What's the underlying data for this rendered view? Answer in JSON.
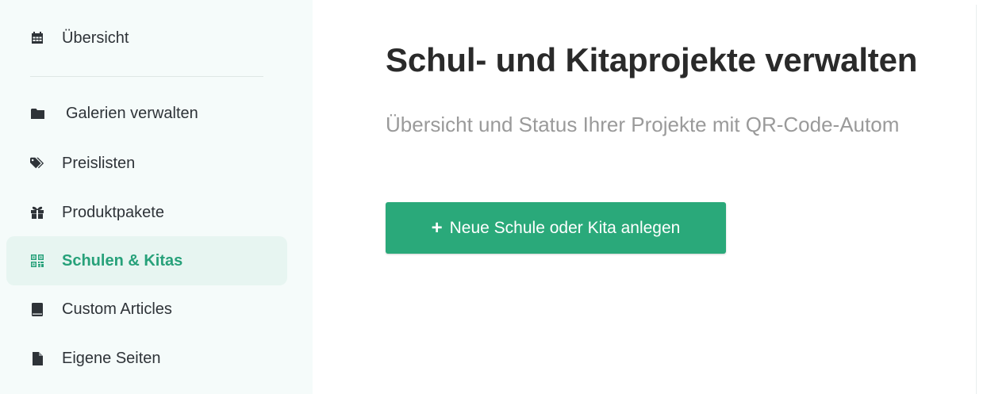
{
  "sidebar": {
    "items": [
      {
        "label": "Übersicht",
        "icon": "calendar-icon",
        "active": false
      },
      {
        "label": "Galerien verwalten",
        "icon": "folder-icon",
        "active": false
      },
      {
        "label": "Preislisten",
        "icon": "tags-icon",
        "active": false
      },
      {
        "label": "Produktpakete",
        "icon": "gift-icon",
        "active": false
      },
      {
        "label": "Schulen & Kitas",
        "icon": "qrcode-icon",
        "active": true
      },
      {
        "label": "Custom Articles",
        "icon": "book-icon",
        "active": false
      },
      {
        "label": "Eigene Seiten",
        "icon": "file-icon",
        "active": false
      }
    ]
  },
  "main": {
    "title": "Schul- und Kitaprojekte verwalten",
    "subtitle": "Übersicht und Status Ihrer Projekte mit QR-Code-Autom",
    "add_button": {
      "plus": "+",
      "label": "Neue Schule oder Kita anlegen"
    }
  },
  "colors": {
    "accent": "#2aa97a",
    "active_text": "#27a17a",
    "active_bg": "#e7f5f1",
    "sidebar_bg": "#f5fbfa",
    "title": "#2a2a2a",
    "subtitle": "#9a9a9a"
  }
}
